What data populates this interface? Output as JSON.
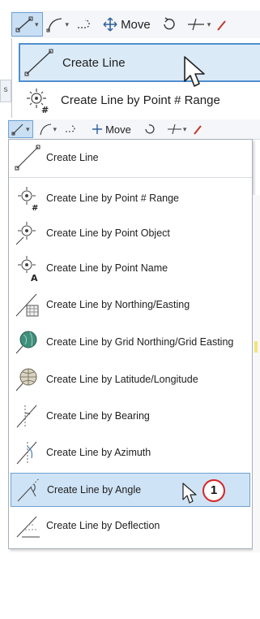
{
  "toolbar": {
    "move_label": "Move",
    "caret": "▾"
  },
  "inset": {
    "create_line": "Create Line",
    "create_line_by_point_range": "Create Line by Point # Range",
    "side_stub": "s"
  },
  "menu": {
    "items": [
      {
        "label": "Create Line",
        "icon": "line-icon"
      },
      {
        "label": "Create Line by Point # Range",
        "icon": "point-range-icon"
      },
      {
        "label": "Create Line by Point Object",
        "icon": "point-object-icon"
      },
      {
        "label": "Create Line by Point Name",
        "icon": "point-name-icon"
      },
      {
        "label": "Create Line by Northing/Easting",
        "icon": "northing-easting-icon"
      },
      {
        "label": "Create Line by Grid Northing/Grid Easting",
        "icon": "grid-globe-icon"
      },
      {
        "label": "Create Line by Latitude/Longitude",
        "icon": "lat-long-icon"
      },
      {
        "label": "Create Line by Bearing",
        "icon": "bearing-icon"
      },
      {
        "label": "Create Line by Azimuth",
        "icon": "azimuth-icon"
      },
      {
        "label": "Create Line by Angle",
        "icon": "angle-icon"
      },
      {
        "label": "Create Line by Deflection",
        "icon": "deflection-icon"
      }
    ],
    "highlighted_index": 9
  },
  "callout": {
    "number": "1"
  },
  "colors": {
    "highlight": "#cfe3f6",
    "highlight_border": "#6ea1d2",
    "callout_ring": "#d62222"
  }
}
